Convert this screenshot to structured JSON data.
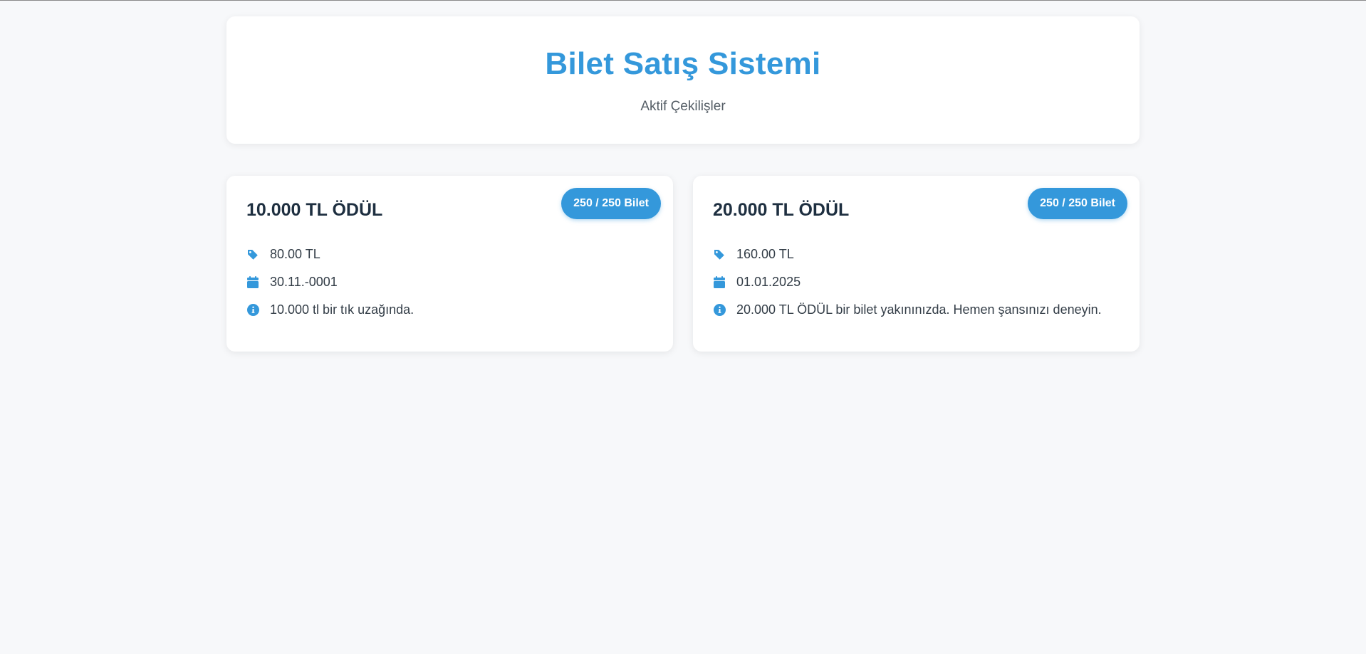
{
  "header": {
    "title": "Bilet Satış Sistemi",
    "subtitle": "Aktif Çekilişler"
  },
  "colors": {
    "accent": "#3498db",
    "background": "#f7f8fa"
  },
  "lotteries": [
    {
      "title": "10.000 TL ÖDÜL",
      "badge": "250 / 250 Bilet",
      "price": "80.00 TL",
      "date": "30.11.-0001",
      "description": "10.000 tl bir tık uzağında.",
      "icons": [
        "tag-icon",
        "calendar-icon",
        "info-icon"
      ]
    },
    {
      "title": "20.000 TL ÖDÜL",
      "badge": "250 / 250 Bilet",
      "price": "160.00 TL",
      "date": "01.01.2025",
      "description": "20.000 TL ÖDÜL bir bilet yakınınızda. Hemen şansınızı deneyin.",
      "icons": [
        "tag-icon",
        "calendar-icon",
        "info-icon"
      ]
    }
  ]
}
